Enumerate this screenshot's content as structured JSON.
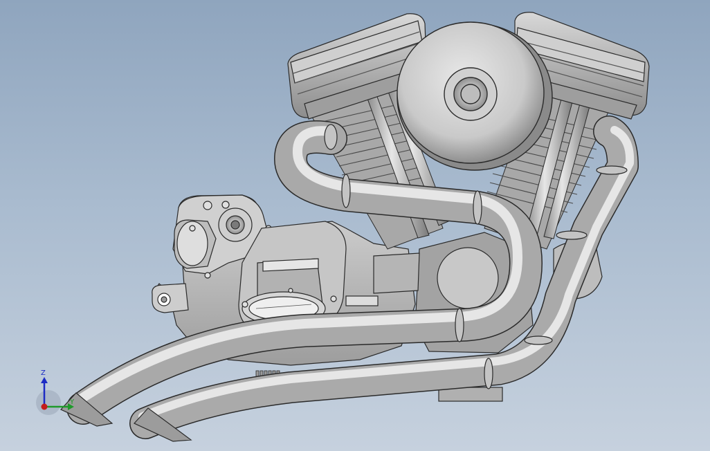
{
  "viewport": {
    "background_top": "#8fa5be",
    "background_bottom": "#c6d1de"
  },
  "model": {
    "subject": "v-twin-engine-with-exhaust",
    "metal_light": "#e4e4e4",
    "metal_mid": "#b9b9b9",
    "metal_dark": "#6f6f6f",
    "edge_color": "#2a2a2a"
  },
  "triad": {
    "z_label": "Z",
    "y_label": "Y",
    "z_color": "#1c2bc4",
    "y_color": "#1e9a2a",
    "x_color": "#c41c1c"
  }
}
